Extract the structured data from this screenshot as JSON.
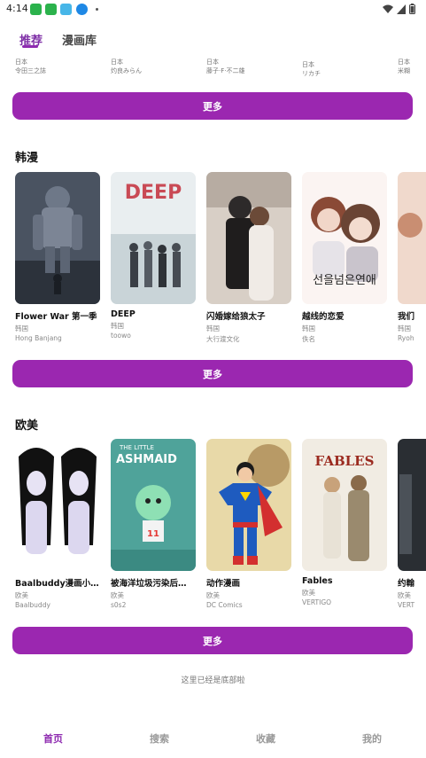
{
  "status": {
    "time": "4:14"
  },
  "tabs": [
    {
      "label": "推荐"
    },
    {
      "label": "漫画库"
    }
  ],
  "top_row": [
    {
      "region": "日本",
      "author": "令田三之誌"
    },
    {
      "region": "日本",
      "author": "灼良みらん"
    },
    {
      "region": "日本",
      "author": "藤子·F·不二雄"
    },
    {
      "region": "日本",
      "author": "リカチ"
    },
    {
      "region": "日本",
      "author": "米糊"
    }
  ],
  "more_label": "更多",
  "sections": [
    {
      "title": "韩漫",
      "items": [
        {
          "title": "Flower War 第一季",
          "region": "韩国",
          "author": "Hong Banjang"
        },
        {
          "title": "DEEP",
          "region": "韩国",
          "author": "toowo"
        },
        {
          "title": "闪婚嫁给狼太子",
          "region": "韩国",
          "author": "大行渡文化"
        },
        {
          "title": "越线的恋爱",
          "region": "韩国",
          "author": "佚名"
        },
        {
          "title": "我们",
          "region": "韩国",
          "author": "Ryoh"
        }
      ]
    },
    {
      "title": "欧美",
      "items": [
        {
          "title": "Baalbuddy漫画小…",
          "region": "欧美",
          "author": "Baalbuddy"
        },
        {
          "title": "被海洋垃圾污染后…",
          "region": "欧美",
          "author": "s0s2"
        },
        {
          "title": "动作漫画",
          "region": "欧美",
          "author": "DC Comics"
        },
        {
          "title": "Fables",
          "region": "欧美",
          "author": "VERTIGO"
        },
        {
          "title": "约翰",
          "region": "欧美",
          "author": "VERT"
        }
      ]
    }
  ],
  "cover_text": {
    "deep": "DEEP",
    "korean": "선을넘은연애",
    "ashmaid_small": "THE LITTLE",
    "ashmaid": "ASHMAID",
    "fables": "FABLES"
  },
  "footer_note": "这里已经是底部啦",
  "nav": [
    {
      "label": "首页"
    },
    {
      "label": "搜索"
    },
    {
      "label": "收藏"
    },
    {
      "label": "我的"
    }
  ],
  "colors": {
    "accent": "#9b27b0",
    "active_tab": "#8e2bb0"
  }
}
